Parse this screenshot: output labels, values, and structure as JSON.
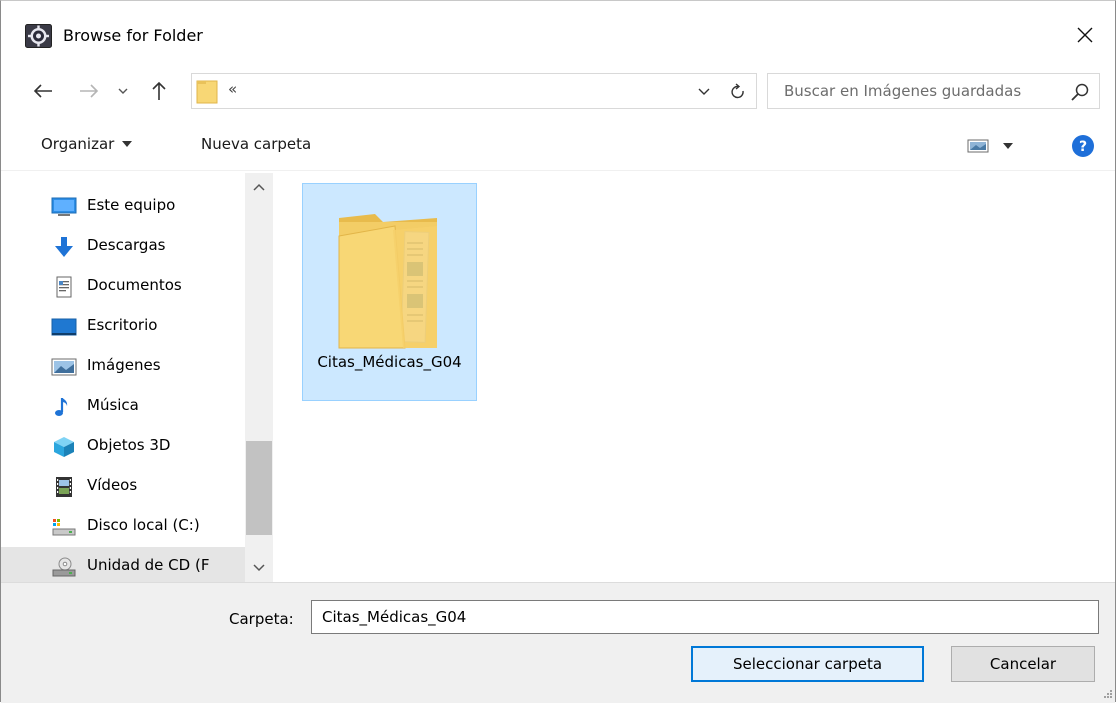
{
  "window": {
    "title": "Browse for Folder",
    "app_icon": "app-gear-icon",
    "close_icon": "close-icon"
  },
  "address_bar": {
    "back_icon": "back-arrow-icon",
    "forward_icon": "forward-arrow-icon",
    "recent_icon": "chevron-down-icon",
    "up_icon": "up-arrow-icon",
    "path_text": "«",
    "dropdown_icon": "chevron-down-icon",
    "refresh_icon": "refresh-icon"
  },
  "search": {
    "placeholder": "Buscar en Imágenes guardadas",
    "icon": "search-icon"
  },
  "toolbar": {
    "organize_label": "Organizar",
    "new_folder_label": "Nueva carpeta",
    "view_icon": "view-options-icon",
    "help_icon": "help-icon"
  },
  "nav_pane": {
    "items": [
      {
        "label": "Este equipo",
        "icon": "computer-icon",
        "selected": false
      },
      {
        "label": "Descargas",
        "icon": "downloads-icon",
        "selected": false
      },
      {
        "label": "Documentos",
        "icon": "documents-icon",
        "selected": false
      },
      {
        "label": "Escritorio",
        "icon": "desktop-icon",
        "selected": false
      },
      {
        "label": "Imágenes",
        "icon": "pictures-icon",
        "selected": false
      },
      {
        "label": "Música",
        "icon": "music-icon",
        "selected": false
      },
      {
        "label": "Objetos 3D",
        "icon": "3d-objects-icon",
        "selected": false
      },
      {
        "label": "Vídeos",
        "icon": "videos-icon",
        "selected": false
      },
      {
        "label": "Disco local (C:)",
        "icon": "local-disk-icon",
        "selected": false
      },
      {
        "label": "Unidad de CD (F",
        "icon": "cd-drive-icon",
        "selected": true
      }
    ]
  },
  "content": {
    "items": [
      {
        "name": "Citas_Médicas_G04",
        "icon": "folder-icon",
        "selected": true
      }
    ]
  },
  "footer": {
    "folder_label": "Carpeta:",
    "folder_value": "Citas_Médicas_G04",
    "select_button": "Seleccionar carpeta",
    "cancel_button": "Cancelar"
  },
  "colors": {
    "selection_bg": "#cce8ff",
    "selection_border": "#99d1ff",
    "accent": "#0078d7",
    "folder_yellow": "#f8d775",
    "help_blue": "#1e6fd9"
  }
}
